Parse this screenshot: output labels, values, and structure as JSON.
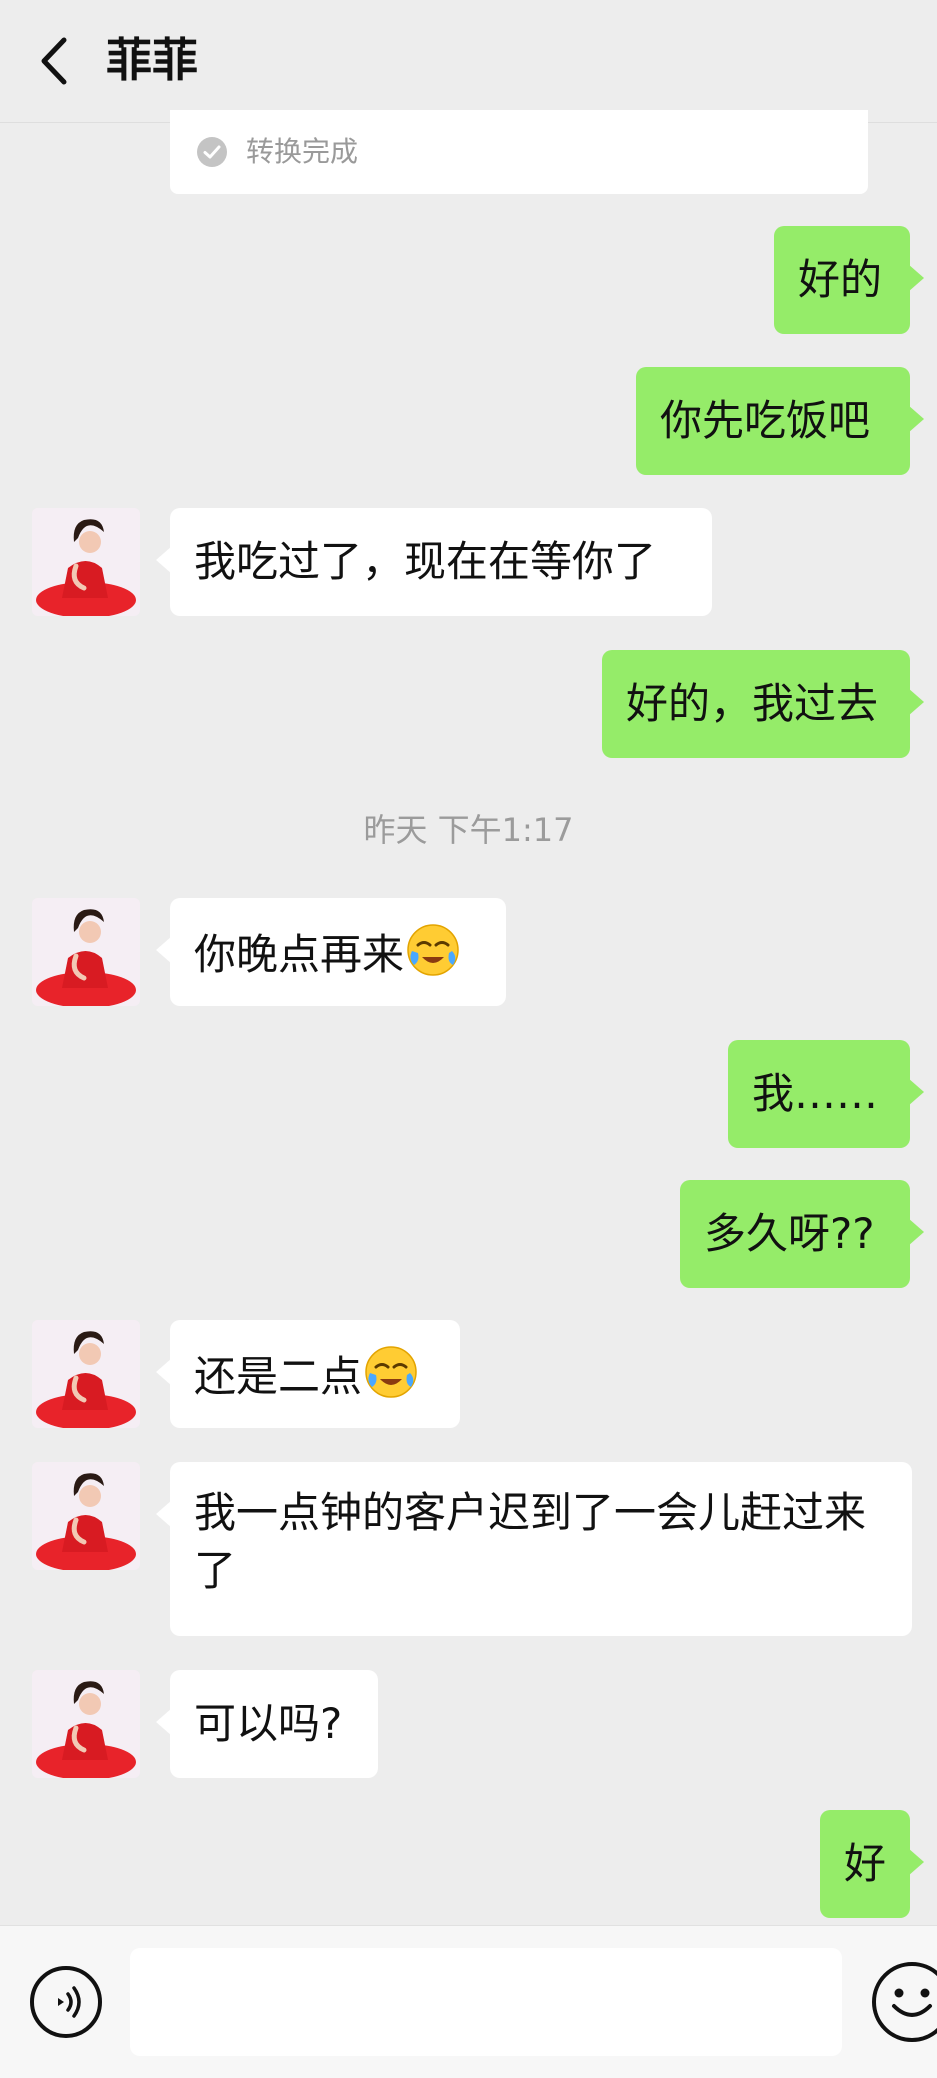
{
  "header": {
    "title": "菲菲"
  },
  "conversion_card": {
    "text": "转换完成"
  },
  "timestamp": "昨天 下午1:17",
  "messages": [
    {
      "dir": "out",
      "text": "好的"
    },
    {
      "dir": "out",
      "text": "你先吃饭吧"
    },
    {
      "dir": "in",
      "text": "我吃过了，现在在等你了"
    },
    {
      "dir": "out",
      "text": "好的，我过去"
    },
    {
      "dir": "in",
      "text": "你晚点再来",
      "emoji": "face-with-tears-emoji"
    },
    {
      "dir": "out",
      "text": "我……"
    },
    {
      "dir": "out",
      "text": "多久呀??"
    },
    {
      "dir": "in",
      "text": "还是二点",
      "emoji": "face-with-tears-emoji"
    },
    {
      "dir": "in",
      "text": "我一点钟的客户迟到了一会儿赶过来了"
    },
    {
      "dir": "in",
      "text": "可以吗?"
    },
    {
      "dir": "out",
      "text": "好"
    }
  ],
  "input": {
    "value": "",
    "placeholder": ""
  },
  "icons": {
    "back": "chevron-left-icon",
    "voice": "voice-icon",
    "emoji": "emoji-icon",
    "check": "check-circle-icon"
  },
  "colors": {
    "outgoing_bubble": "#95ec69",
    "incoming_bubble": "#ffffff",
    "background": "#ededed"
  }
}
